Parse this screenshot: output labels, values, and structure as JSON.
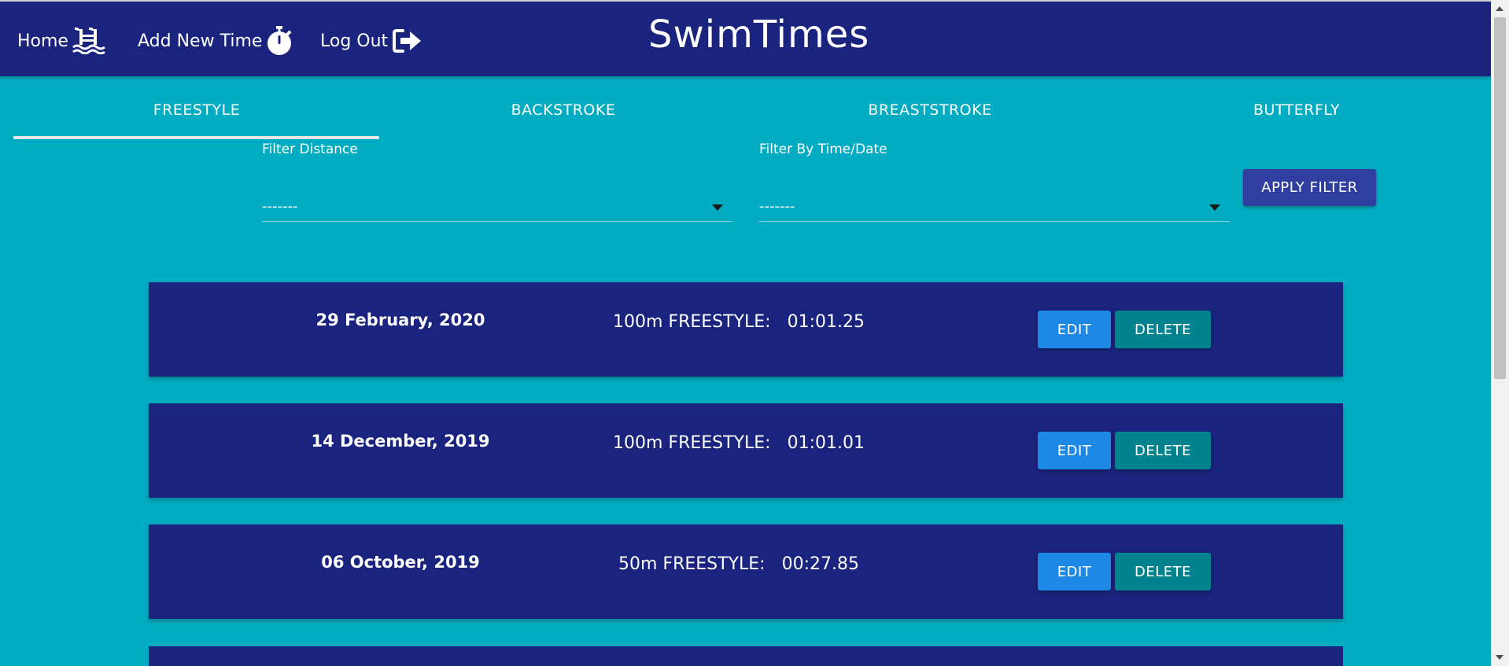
{
  "nav": {
    "home_label": "Home",
    "home_icon": "swimming-pool-icon",
    "add_label": "Add New Time",
    "add_icon": "stopwatch-icon",
    "logout_label": "Log Out",
    "logout_icon": "sign-out-icon",
    "brand": "SwimTimes"
  },
  "tabs": [
    {
      "label": "FREESTYLE",
      "selected": true
    },
    {
      "label": "BACKSTROKE",
      "selected": false
    },
    {
      "label": "BREASTSTROKE",
      "selected": false
    },
    {
      "label": "BUTTERFLY",
      "selected": false
    }
  ],
  "filters": {
    "distance_label": "Filter Distance",
    "distance_value": "-------",
    "time_label": "Filter By Time/Date",
    "time_value": "-------",
    "apply_label": "APPLY FILTER"
  },
  "results": [
    {
      "date": "29 February, 2020",
      "event": "100m FREESTYLE:",
      "time": "01:01.25",
      "edit_label": "EDIT",
      "delete_label": "DELETE"
    },
    {
      "date": "14 December, 2019",
      "event": "100m FREESTYLE:",
      "time": "01:01.01",
      "edit_label": "EDIT",
      "delete_label": "DELETE"
    },
    {
      "date": "06 October, 2019",
      "event": "50m FREESTYLE:",
      "time": "00:27.85",
      "edit_label": "EDIT",
      "delete_label": "DELETE"
    }
  ],
  "colors": {
    "navbar": "#1a237e",
    "background": "#00acc1",
    "card": "#1a237e",
    "edit_button": "#1e88e5",
    "delete_button": "#00838f",
    "apply_button": "#303f9f"
  }
}
